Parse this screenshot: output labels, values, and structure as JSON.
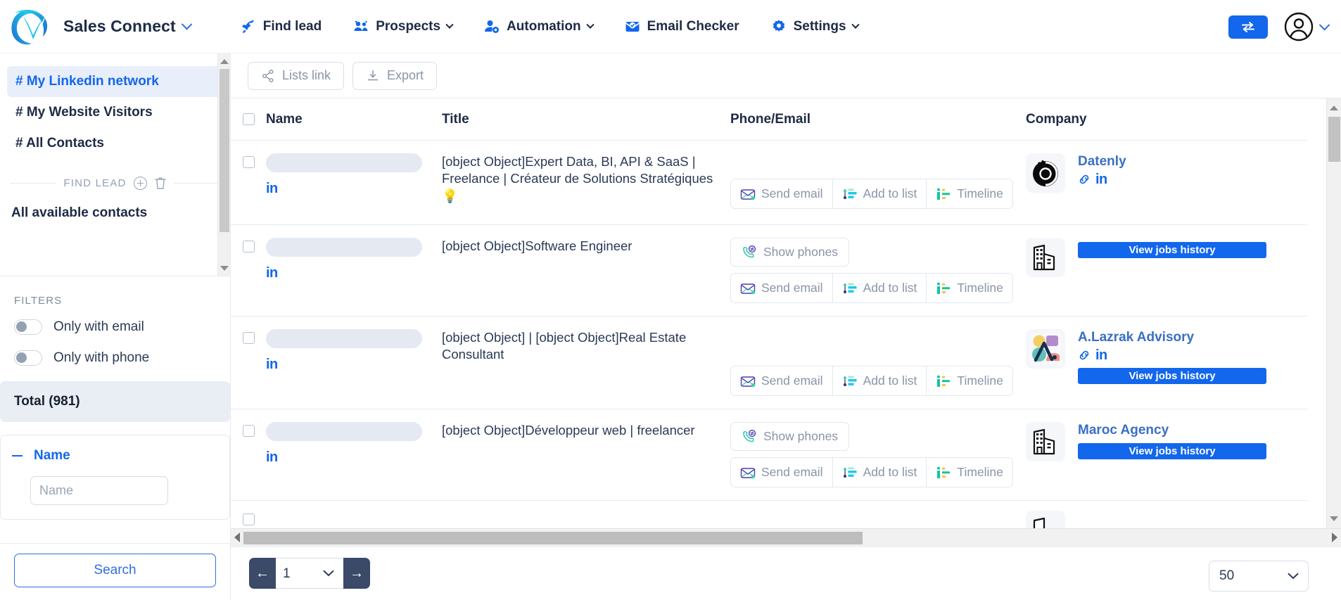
{
  "header": {
    "logo_icon": "sales-connect-logo",
    "brand_name": "Sales Connect",
    "nav": [
      {
        "label": "Find lead",
        "icon": "rocket-icon",
        "has_caret": false
      },
      {
        "label": "Prospects",
        "icon": "people-icon",
        "has_caret": true
      },
      {
        "label": "Automation",
        "icon": "user-gear-icon",
        "has_caret": true
      },
      {
        "label": "Email Checker",
        "icon": "email-check-icon",
        "has_caret": false
      },
      {
        "label": "Settings",
        "icon": "gear-icon",
        "has_caret": true
      }
    ],
    "swap_icon": "swap-arrows-icon",
    "avatar_icon": "user-circle-icon",
    "avatar_caret_icon": "chevron-down-icon"
  },
  "sidebar": {
    "lists": [
      {
        "label": "# My Linkedin network",
        "active": true
      },
      {
        "label": "# My Website Visitors",
        "active": false
      },
      {
        "label": "# All Contacts",
        "active": false
      }
    ],
    "divider_label": "FIND LEAD",
    "add_icon": "plus-circle-icon",
    "delete_icon": "trash-icon",
    "all_available_contacts": "All available contacts",
    "filters_title": "FILTERS",
    "toggles": [
      {
        "label": "Only with email",
        "on": false
      },
      {
        "label": "Only with phone",
        "on": false
      }
    ],
    "total_label": "Total (981)",
    "name_section": {
      "label": "Name",
      "collapse_icon": "minus-icon",
      "placeholder": "Name",
      "value": ""
    },
    "search_label": "Search"
  },
  "toolbar": {
    "lists_link_label": "Lists link",
    "lists_link_icon": "share-icon",
    "export_label": "Export",
    "export_icon": "download-icon"
  },
  "table": {
    "columns": [
      "Name",
      "Title",
      "Phone/Email",
      "Company"
    ],
    "select_all_checked": false,
    "rows": [
      {
        "name_hidden": true,
        "linkedin_badge": "in",
        "title": "[object Object]Expert Data, BI, API & SaaS | Freelance | Créateur de Solutions Stratégiques 💡",
        "show_phones": false,
        "actions": [
          "Send email",
          "Add to list",
          "Timeline"
        ],
        "company": {
          "name": "Datenly",
          "logo": "datenly-logo",
          "has_link": true,
          "has_linkedin": true,
          "jobs_button": null
        }
      },
      {
        "name_hidden": true,
        "linkedin_badge": "in",
        "title": "[object Object]Software Engineer",
        "show_phones": true,
        "show_phones_label": "Show phones",
        "actions": [
          "Send email",
          "Add to list",
          "Timeline"
        ],
        "company": {
          "name": "",
          "logo": "building-icon",
          "has_link": false,
          "has_linkedin": false,
          "jobs_button": "View jobs history"
        }
      },
      {
        "name_hidden": true,
        "linkedin_badge": "in",
        "title": "[object Object] | [object Object]Real Estate Consultant",
        "show_phones": false,
        "actions": [
          "Send email",
          "Add to list",
          "Timeline"
        ],
        "company": {
          "name": "A.Lazrak Advisory",
          "logo": "alazrak-logo",
          "has_link": true,
          "has_linkedin": true,
          "jobs_button": "View jobs history"
        }
      },
      {
        "name_hidden": true,
        "linkedin_badge": "in",
        "title": "[object Object]Développeur web | freelancer",
        "show_phones": true,
        "show_phones_label": "Show phones",
        "actions": [
          "Send email",
          "Add to list",
          "Timeline"
        ],
        "company": {
          "name": "Maroc Agency",
          "logo": "building-icon",
          "has_link": false,
          "has_linkedin": false,
          "jobs_button": "View jobs history"
        }
      }
    ],
    "action_icons": {
      "send_email": "envelope-icon",
      "add_to_list": "list-add-icon",
      "timeline": "timeline-icon",
      "show_phones": "phone-refresh-icon"
    }
  },
  "footer": {
    "prev_icon": "arrow-left-icon",
    "next_icon": "arrow-right-icon",
    "page_value": "1",
    "page_options": [
      "1"
    ],
    "per_page_value": "50",
    "per_page_options": [
      "50"
    ]
  },
  "colors": {
    "accent": "#1267ec",
    "brand_dark": "#1d2b45",
    "active_bg": "#e9eefb",
    "muted": "#8a95a6"
  }
}
